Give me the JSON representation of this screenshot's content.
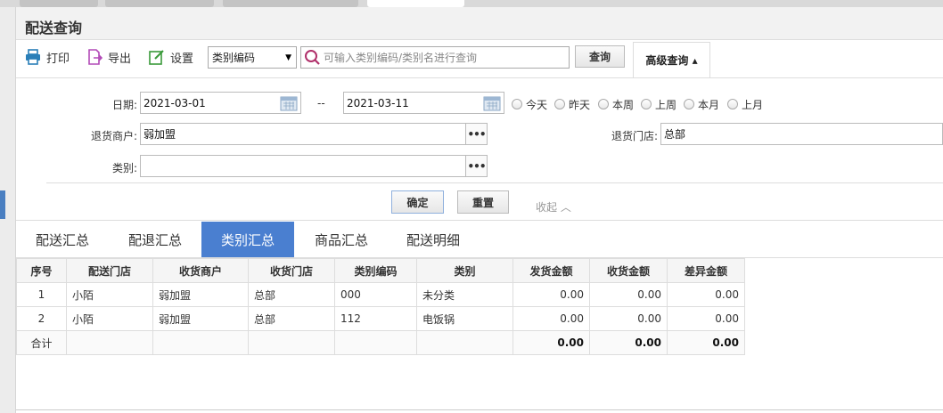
{
  "page": {
    "title": "配送查询"
  },
  "toolbar": {
    "print_label": "打印",
    "export_label": "导出",
    "settings_label": "设置",
    "select_value": "类别编码",
    "search_placeholder": "可输入类别编码/类别名进行查询",
    "query_label": "查询",
    "advanced_label": "高级查询 ▴"
  },
  "form": {
    "date_label": "日期:",
    "date_from": "2021-03-01",
    "date_sep": "--",
    "date_to": "2021-03-11",
    "quick_dates": [
      "今天",
      "昨天",
      "本周",
      "上周",
      "本月",
      "上月"
    ],
    "merchant_label": "退货商户:",
    "merchant_value": "弱加盟",
    "store_label": "退货门店:",
    "store_value": "总部",
    "category_label": "类别:",
    "category_value": "",
    "confirm_label": "确定",
    "reset_label": "重置",
    "collapse_label": "收起 ︿"
  },
  "tabs": [
    "配送汇总",
    "配退汇总",
    "类别汇总",
    "商品汇总",
    "配送明细"
  ],
  "active_tab": "类别汇总",
  "table": {
    "headers": [
      "序号",
      "配送门店",
      "收货商户",
      "收货门店",
      "类别编码",
      "类别",
      "发货金额",
      "收货金额",
      "差异金额"
    ],
    "rows": [
      [
        "1",
        "小陌",
        "弱加盟",
        "总部",
        "000",
        "未分类",
        "0.00",
        "0.00",
        "0.00"
      ],
      [
        "2",
        "小陌",
        "弱加盟",
        "总部",
        "112",
        "电饭锅",
        "0.00",
        "0.00",
        "0.00"
      ]
    ],
    "total": [
      "合计",
      "",
      "",
      "",
      "",
      "",
      "0.00",
      "0.00",
      "0.00"
    ]
  },
  "colors": {
    "accent": "#4a7fd0",
    "print_icon": "#2a7fb8",
    "export_icon": "#b24ab7",
    "settings_icon": "#3a9a3a"
  }
}
